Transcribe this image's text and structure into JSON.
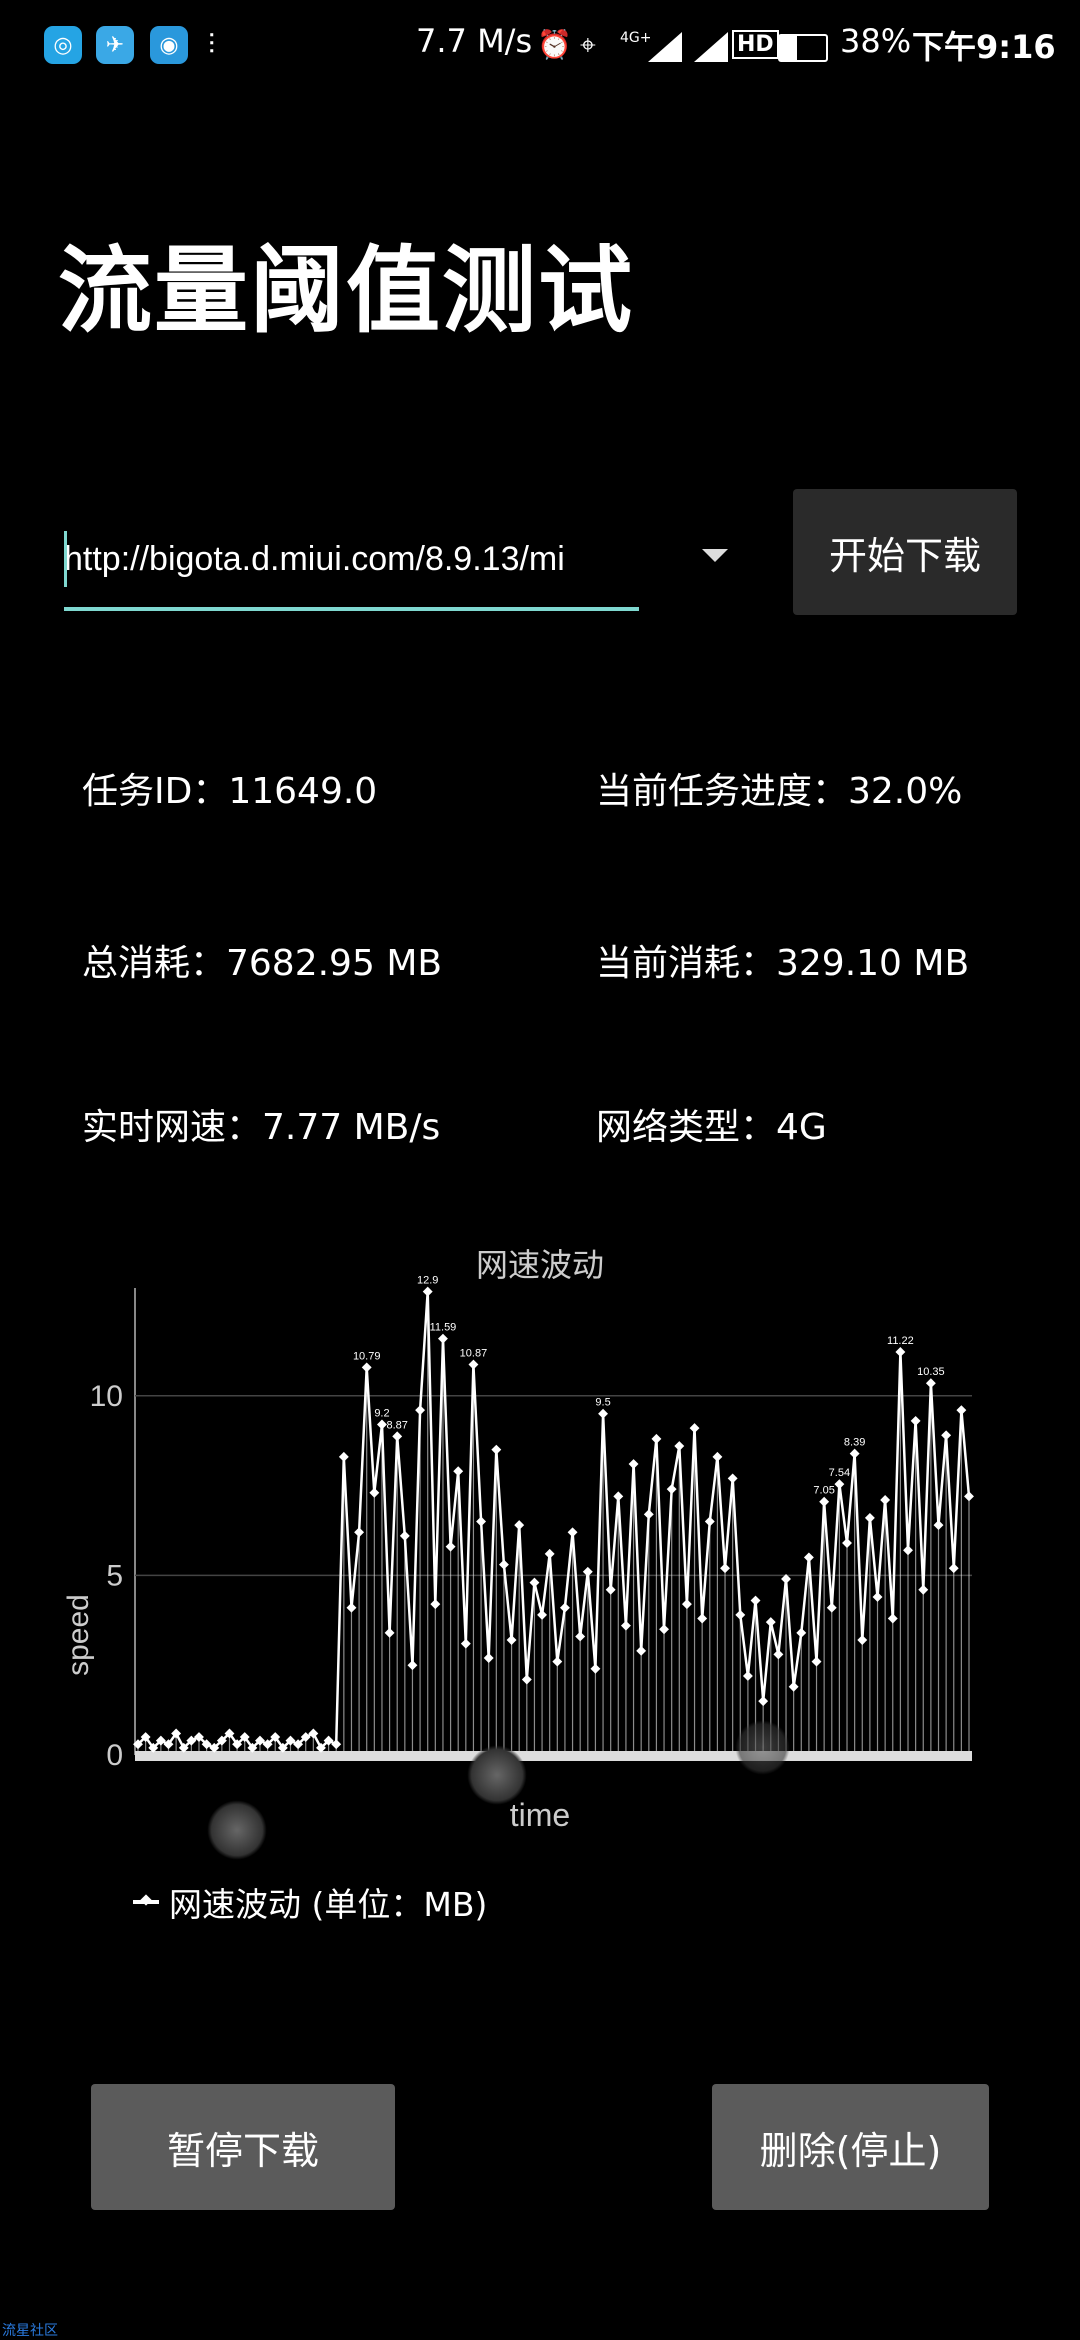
{
  "status_bar": {
    "speed": "7.7 M/s",
    "signal_4g": "4G+",
    "hd": "HD",
    "battery": "38%",
    "time": "下午9:16",
    "icons": [
      "app-circle-icon",
      "app-plane-icon",
      "app-compass-icon",
      "equalizer-icon",
      "alarm-icon",
      "location-icon",
      "signal-icon",
      "hd-icon",
      "battery-icon"
    ]
  },
  "page": {
    "title": "流量阈值测试"
  },
  "download": {
    "url": "http://bigota.d.miui.com/8.9.13/mi",
    "start_label": "开始下载"
  },
  "info": {
    "task_id": "任务ID：11649.0",
    "progress": "当前任务进度：32.0%",
    "total_usage": "总消耗：7682.95 MB",
    "current_usage": "当前消耗：329.10 MB",
    "speed": "实时网速：7.77 MB/s",
    "network": "网络类型：4G"
  },
  "chart_data": {
    "type": "line",
    "title": "网速波动",
    "xlabel": "time",
    "ylabel": "speed",
    "ylim": [
      0,
      13
    ],
    "yticks": [
      "0",
      "5",
      "10"
    ],
    "series": [
      {
        "name": "网速波动 (单位：MB)",
        "values": [
          0.3,
          0.5,
          0.2,
          0.4,
          0.3,
          0.6,
          0.2,
          0.4,
          0.5,
          0.3,
          0.2,
          0.4,
          0.6,
          0.3,
          0.5,
          0.2,
          0.4,
          0.3,
          0.5,
          0.2,
          0.4,
          0.3,
          0.5,
          0.6,
          0.2,
          0.4,
          0.3,
          8.3,
          4.1,
          6.2,
          10.79,
          7.3,
          9.2,
          3.4,
          8.87,
          6.1,
          2.5,
          9.6,
          12.9,
          4.2,
          11.59,
          5.8,
          7.9,
          3.1,
          10.87,
          6.5,
          2.7,
          8.5,
          5.3,
          3.2,
          6.4,
          2.1,
          4.8,
          3.9,
          5.6,
          2.6,
          4.1,
          6.2,
          3.3,
          5.1,
          2.4,
          9.5,
          4.6,
          7.2,
          3.6,
          8.1,
          2.9,
          6.7,
          8.8,
          3.5,
          7.4,
          8.6,
          4.2,
          9.1,
          3.8,
          6.5,
          8.3,
          5.2,
          7.7,
          3.9,
          2.2,
          4.3,
          1.5,
          3.7,
          2.8,
          4.9,
          1.9,
          3.4,
          5.5,
          2.6,
          7.05,
          4.1,
          7.54,
          5.9,
          8.39,
          3.2,
          6.6,
          4.4,
          7.1,
          3.8,
          11.22,
          5.7,
          9.3,
          4.6,
          10.35,
          6.4,
          8.9,
          5.2,
          9.6,
          7.2
        ]
      }
    ],
    "data_labels": [
      "12.9",
      "11.59",
      "10.79",
      "10.87",
      "9.5",
      "9.2",
      "8.87",
      "8.39",
      "7.54",
      "7.05",
      "11.22",
      "10.35"
    ],
    "grid": true,
    "legend_position": "bottom-left"
  },
  "buttons": {
    "pause_label": "暂停下载",
    "delete_label": "删除(停止)"
  },
  "watermark": "流星社区"
}
